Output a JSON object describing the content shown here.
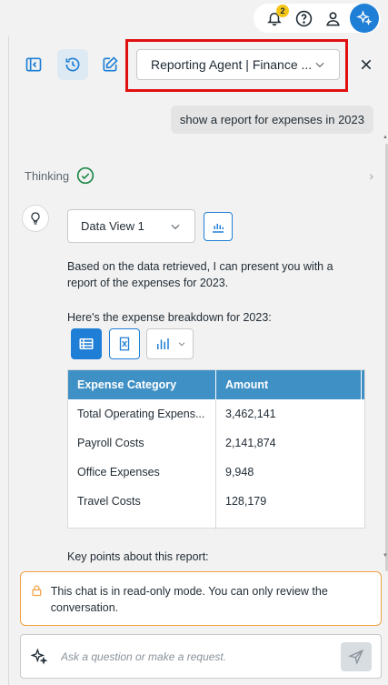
{
  "topbar": {
    "notifications_count": "2",
    "icons": [
      "bell-icon",
      "help-icon",
      "user-icon",
      "assistant-sparkle-icon"
    ]
  },
  "header": {
    "agent_select_value": "Reporting Agent | Finance ...",
    "icons": [
      "collapse-panel-icon",
      "history-icon",
      "new-chat-icon",
      "close-icon"
    ]
  },
  "conversation": {
    "user_message": "show a report for expenses in 2023",
    "thinking_label": "Thinking",
    "dataview_value": "Data View 1",
    "intro_text": "Based on the data retrieved, I can present you with a report of the expenses for 2023.",
    "breakdown_text": "Here's the expense breakdown for 2023:",
    "table": {
      "headers": [
        "Expense Category",
        "Amount"
      ],
      "rows": [
        [
          "Total Operating Expens...",
          "3,462,141"
        ],
        [
          "Payroll Costs",
          "2,141,874"
        ],
        [
          "Office Expenses",
          "9,948"
        ],
        [
          "Travel Costs",
          "128,179"
        ]
      ]
    },
    "key_points_text": "Key points about this report:"
  },
  "readonly_notice": "This chat is in read-only mode. You can only review the conversation.",
  "input": {
    "placeholder": "Ask a question or make a request."
  },
  "colors": {
    "accent": "#1f7fd6",
    "table_header": "#3f90c4",
    "highlight": "#e01010",
    "warning_border": "#f0a040",
    "success": "#1e8a4a"
  }
}
